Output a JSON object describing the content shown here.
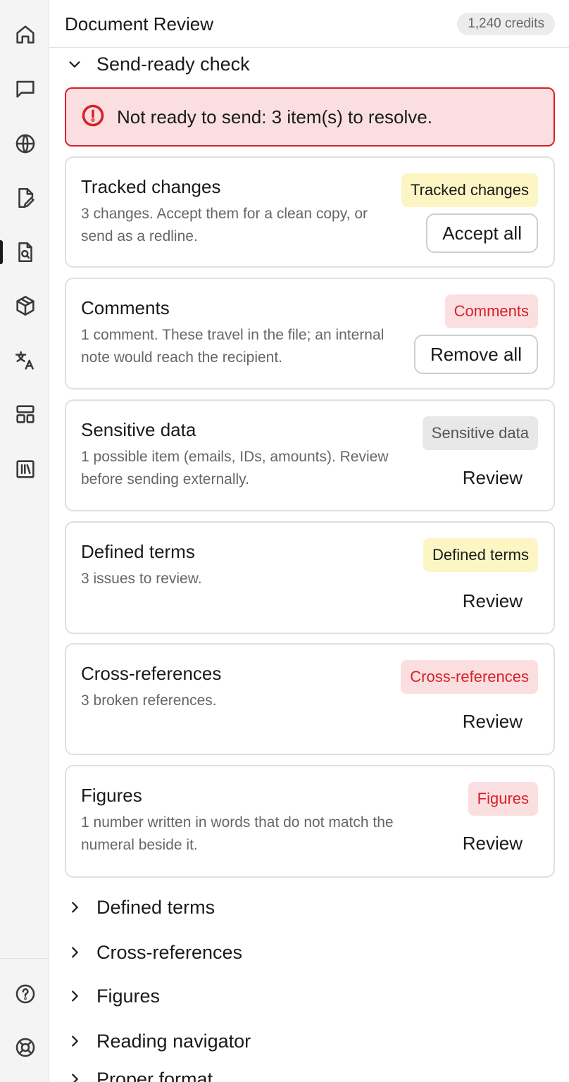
{
  "header": {
    "title": "Document Review",
    "credits": "1,240 credits"
  },
  "rail": {
    "icons": [
      "home-icon",
      "chat-icon",
      "globe-icon",
      "document-edit-icon",
      "document-search-icon",
      "package-icon",
      "translate-icon",
      "layout-icon",
      "library-icon",
      "help-icon",
      "support-icon"
    ],
    "active": "document-search-icon"
  },
  "send_ready": {
    "title": "Send-ready check",
    "alert": "Not ready to send: 3 item(s) to resolve."
  },
  "cards": [
    {
      "title": "Tracked changes",
      "desc": "3 changes. Accept them for a clean copy, or send as a redline.",
      "badge": "Tracked changes",
      "action": "Accept all"
    },
    {
      "title": "Comments",
      "desc": "1 comment. These travel in the file; an internal note would reach the recipient.",
      "badge": "Comments",
      "action": "Remove all"
    },
    {
      "title": "Sensitive data",
      "desc": "1 possible item (emails, IDs, amounts). Review before sending externally.",
      "badge": "Sensitive data",
      "action": "Review"
    },
    {
      "title": "Defined terms",
      "desc": "3 issues to review.",
      "badge": "Defined terms",
      "action": "Review"
    },
    {
      "title": "Cross-references",
      "desc": "3 broken references.",
      "badge": "Cross-references",
      "action": "Review"
    },
    {
      "title": "Figures",
      "desc": "1 number written in words that do not match the numeral beside it.",
      "badge": "Figures",
      "action": "Review"
    }
  ],
  "sections": [
    "Defined terms",
    "Cross-references",
    "Figures",
    "Reading navigator",
    "Proper format"
  ],
  "colors": {
    "alert_red": "#d8202a",
    "alert_bg": "#fbdfe0",
    "badge_yellow_bg": "#fcf6c4",
    "badge_gray_bg": "#e8e8e8"
  }
}
